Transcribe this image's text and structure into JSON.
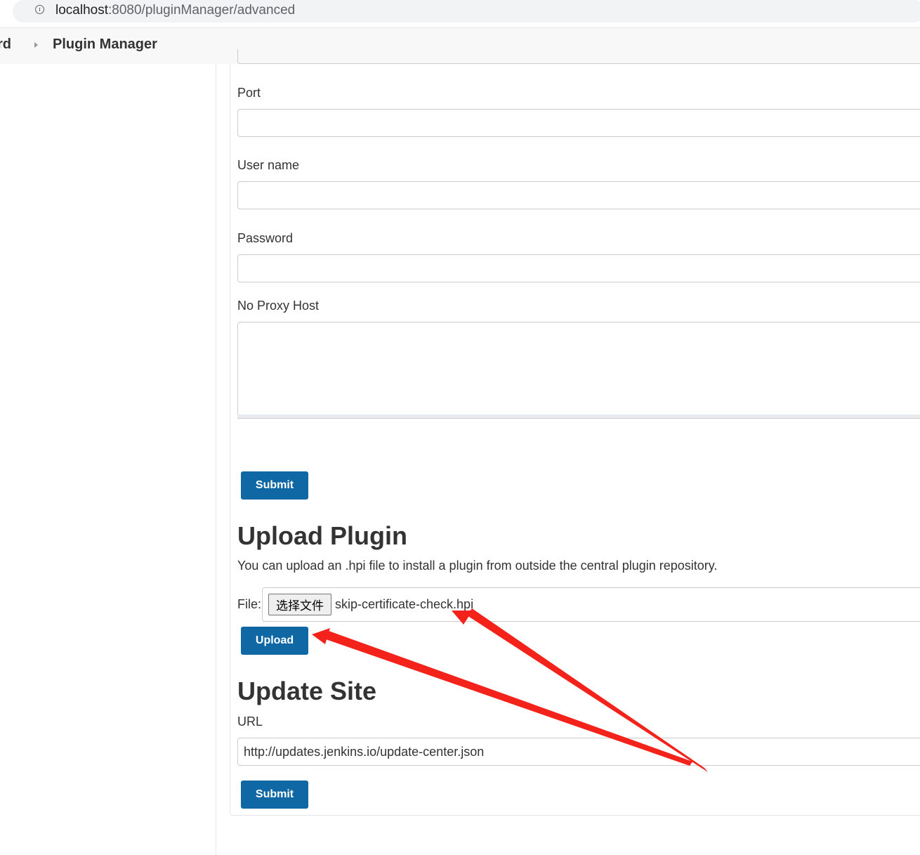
{
  "browser": {
    "url_host": "localhost",
    "url_rest": ":8080/pluginManager/advanced"
  },
  "breadcrumb": {
    "previous": "rd",
    "current": "Plugin Manager"
  },
  "proxy_form": {
    "port_label": "Port",
    "user_label": "User name",
    "password_label": "Password",
    "no_proxy_label": "No Proxy Host",
    "submit_label": "Submit"
  },
  "upload": {
    "heading": "Upload Plugin",
    "description": "You can upload an .hpi file to install a plugin from outside the central plugin repository.",
    "file_label": "File:",
    "choose_label": "选择文件",
    "file_name": "skip-certificate-check.hpi",
    "upload_label": "Upload"
  },
  "update_site": {
    "heading": "Update Site",
    "url_label": "URL",
    "url_value": "http://updates.jenkins.io/update-center.json",
    "submit_label": "Submit"
  },
  "colors": {
    "primary_button": "#0f68a4",
    "annotation_arrow": "#f3231b"
  }
}
